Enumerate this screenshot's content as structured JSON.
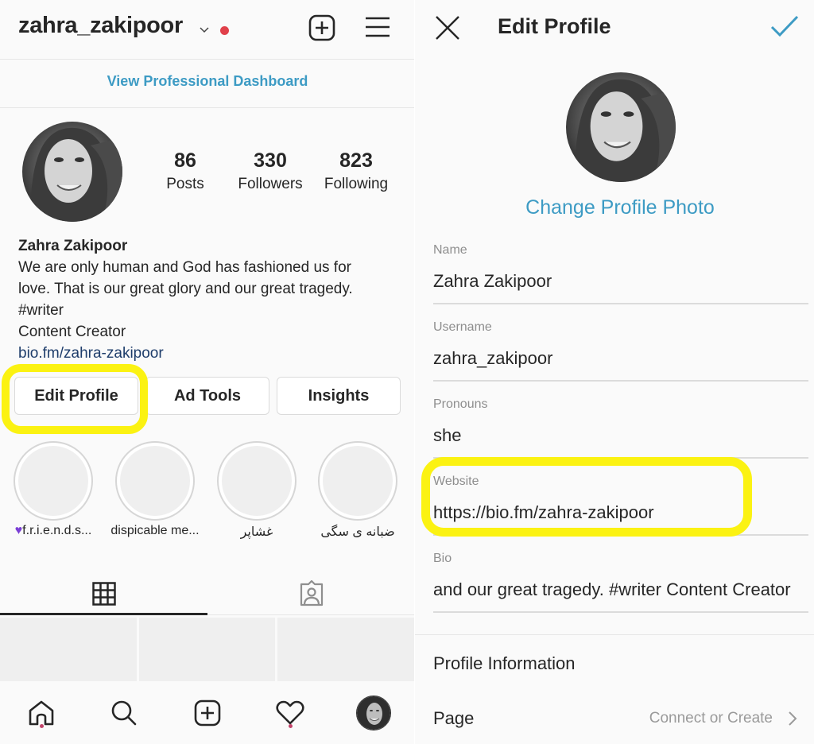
{
  "profile_screen": {
    "username": "zahra_zakipoor",
    "notification_dot_color": "#e0404a",
    "header_icons": [
      "chevron-down-icon",
      "add-post-icon",
      "menu-icon"
    ],
    "dashboard_link": "View Professional Dashboard",
    "stats": [
      {
        "value": "86",
        "label": "Posts"
      },
      {
        "value": "330",
        "label": "Followers"
      },
      {
        "value": "823",
        "label": "Following"
      }
    ],
    "display_name": "Zahra Zakipoor",
    "bio_lines": [
      "We are only human and God has fashioned us for",
      "love. That is our great glory and our great tragedy.",
      "#writer",
      "Content Creator"
    ],
    "bio_link": "bio.fm/zahra-zakipoor",
    "buttons": [
      {
        "label": "Edit Profile",
        "highlighted": true
      },
      {
        "label": "Ad Tools"
      },
      {
        "label": "Insights"
      }
    ],
    "highlights": [
      {
        "label": "f.r.i.e.n.d.s...",
        "prefix_icon": "purple-heart-icon"
      },
      {
        "label": "dispicable me..."
      },
      {
        "label": "غشاپر"
      },
      {
        "label": "ضبانه ی سگی"
      }
    ],
    "tabs": [
      {
        "name": "grid",
        "icon": "grid-icon",
        "active": true
      },
      {
        "name": "tagged",
        "icon": "tagged-icon",
        "active": false
      }
    ],
    "bottom_nav": [
      {
        "name": "home",
        "icon": "home-icon",
        "has_dot": true
      },
      {
        "name": "search",
        "icon": "search-icon",
        "has_dot": false
      },
      {
        "name": "new-post",
        "icon": "add-post-icon",
        "has_dot": false
      },
      {
        "name": "activity",
        "icon": "heart-icon",
        "has_dot": true
      },
      {
        "name": "profile",
        "icon": "avatar",
        "has_dot": false
      }
    ]
  },
  "edit_screen": {
    "title": "Edit Profile",
    "close_icon": "close-icon",
    "confirm_icon": "check-icon",
    "change_photo": "Change Profile Photo",
    "fields": [
      {
        "label": "Name",
        "value": "Zahra Zakipoor"
      },
      {
        "label": "Username",
        "value": "zahra_zakipoor"
      },
      {
        "label": "Pronouns",
        "value": "she"
      },
      {
        "label": "Website",
        "value": "https://bio.fm/zahra-zakipoor",
        "highlighted": true
      },
      {
        "label": "Bio",
        "value": "and our great tragedy.  #writer Content Creator"
      }
    ],
    "profile_information": "Profile Information",
    "page_row": {
      "label": "Page",
      "value": "Connect or Create"
    }
  },
  "colors": {
    "accent_blue": "#3d9bc4",
    "highlight_yellow": "#fbf212",
    "link_navy": "#1e3d6b"
  }
}
